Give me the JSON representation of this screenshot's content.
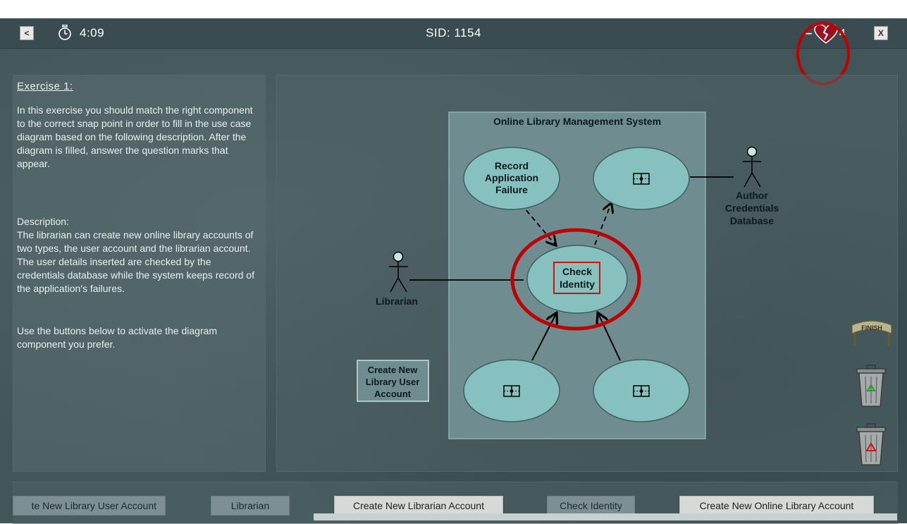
{
  "topbar": {
    "back_label": "<",
    "timer": "4:09",
    "sid": "SID: 1154",
    "lives_dash": "−",
    "lives_count": "4",
    "close_label": "X"
  },
  "exercise": {
    "title": "Exercise 1:",
    "intro": "In this exercise you should match the right component to the correct snap point in order to fill in the use case diagram based on the following description. After the diagram is filled, answer the question marks that appear.",
    "description_heading": "Description:",
    "description": "The librarian can create new online library accounts of two types, the user account and the librarian account. The user details inserted are checked by the credentials database while the system keeps record of the application's failures.",
    "instruction": "Use the buttons below to activate the diagram component you prefer."
  },
  "diagram": {
    "system_title": "Online Library Management System",
    "usecase_record_lines": [
      "Record",
      "Application",
      "Failure"
    ],
    "usecase_check_lines": [
      "Check",
      "Identity"
    ],
    "actor_librarian": "Librarian",
    "actor_author_lines": [
      "Author",
      "Credentials",
      "Database"
    ],
    "floating_lines": [
      "Create New",
      "Library User",
      "Account"
    ],
    "highlight_color": "#c00000"
  },
  "tools": {
    "finish_label": "FINISH"
  },
  "bottom_bar": {
    "buttons": [
      {
        "label": "te New Library User Account",
        "inactive": true
      },
      {
        "label": "Librarian",
        "inactive": true
      },
      {
        "label": "Create New Librarian Account",
        "inactive": false
      },
      {
        "label": "Check Identity",
        "inactive": true
      },
      {
        "label": "Create New Online Library Account",
        "inactive": false
      }
    ]
  }
}
